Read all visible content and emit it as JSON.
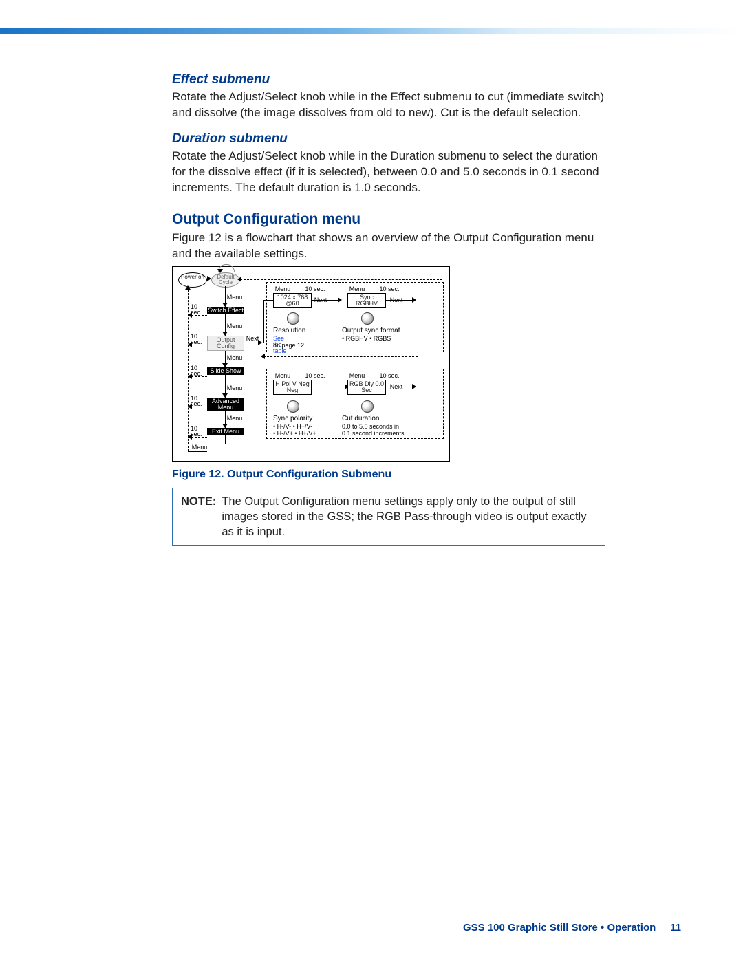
{
  "headings": {
    "effect": "Effect submenu",
    "duration": "Duration submenu",
    "output": "Output Configuration menu"
  },
  "paragraphs": {
    "effect": "Rotate the Adjust/Select knob while in the Effect submenu to cut (immediate switch) and dissolve (the image dissolves from old to new). Cut is the default selection.",
    "duration": "Rotate the Adjust/Select knob while in the Duration submenu to select the duration for the dissolve effect (if it is selected), between 0.0 and 5.0 seconds in 0.1 second increments. The default duration is 1.0 seconds.",
    "output": "Figure 12 is a flowchart that shows an overview of the Output Configuration menu and the available settings."
  },
  "figure_caption": "Figure 12. Output Configuration Submenu",
  "note_label": "NOTE:",
  "note_text": "The Output Configuration menu settings apply only to the output of still images stored in the GSS; the RGB Pass-through video is output exactly as it is input.",
  "footer": {
    "text": "GSS 100 Graphic Still Store • Operation",
    "page": "11"
  },
  "fig": {
    "power_on": "Power on",
    "default_cycle": "Default Cycle",
    "left_menu": [
      "Switch Effect",
      "Output Config",
      "Slide Show",
      "Advanced Menu",
      "Exit Menu"
    ],
    "menu_word": "Menu",
    "next_word": "Next",
    "timeout_10s": "10 sec.",
    "timeout_10s_split": [
      "10",
      "sec."
    ],
    "disp_res": "1024 x 768  @60",
    "disp_sync": "Sync RGBHV",
    "disp_pol": "H Pol V Neg  Neg",
    "disp_rgbdly": "RGB Dly 0.0 Sec",
    "resolution_lbl": "Resolution",
    "seetable": "See the table on page 12.",
    "seetable_link": "See the table",
    "seetable_rest": "on page 12.",
    "osf_lbl": "Output sync format",
    "osf_opts": "• RGBHV  • RGBS",
    "pol_lbl": "Sync polarity",
    "pol_opts1": "• H-/V-   • H+/V-",
    "pol_opts2": "• H-/V+  • H+/V+",
    "cut_lbl": "Cut duration",
    "cut_opts1": "0.0 to 5.0 seconds in",
    "cut_opts2": "0.1 second increments."
  }
}
